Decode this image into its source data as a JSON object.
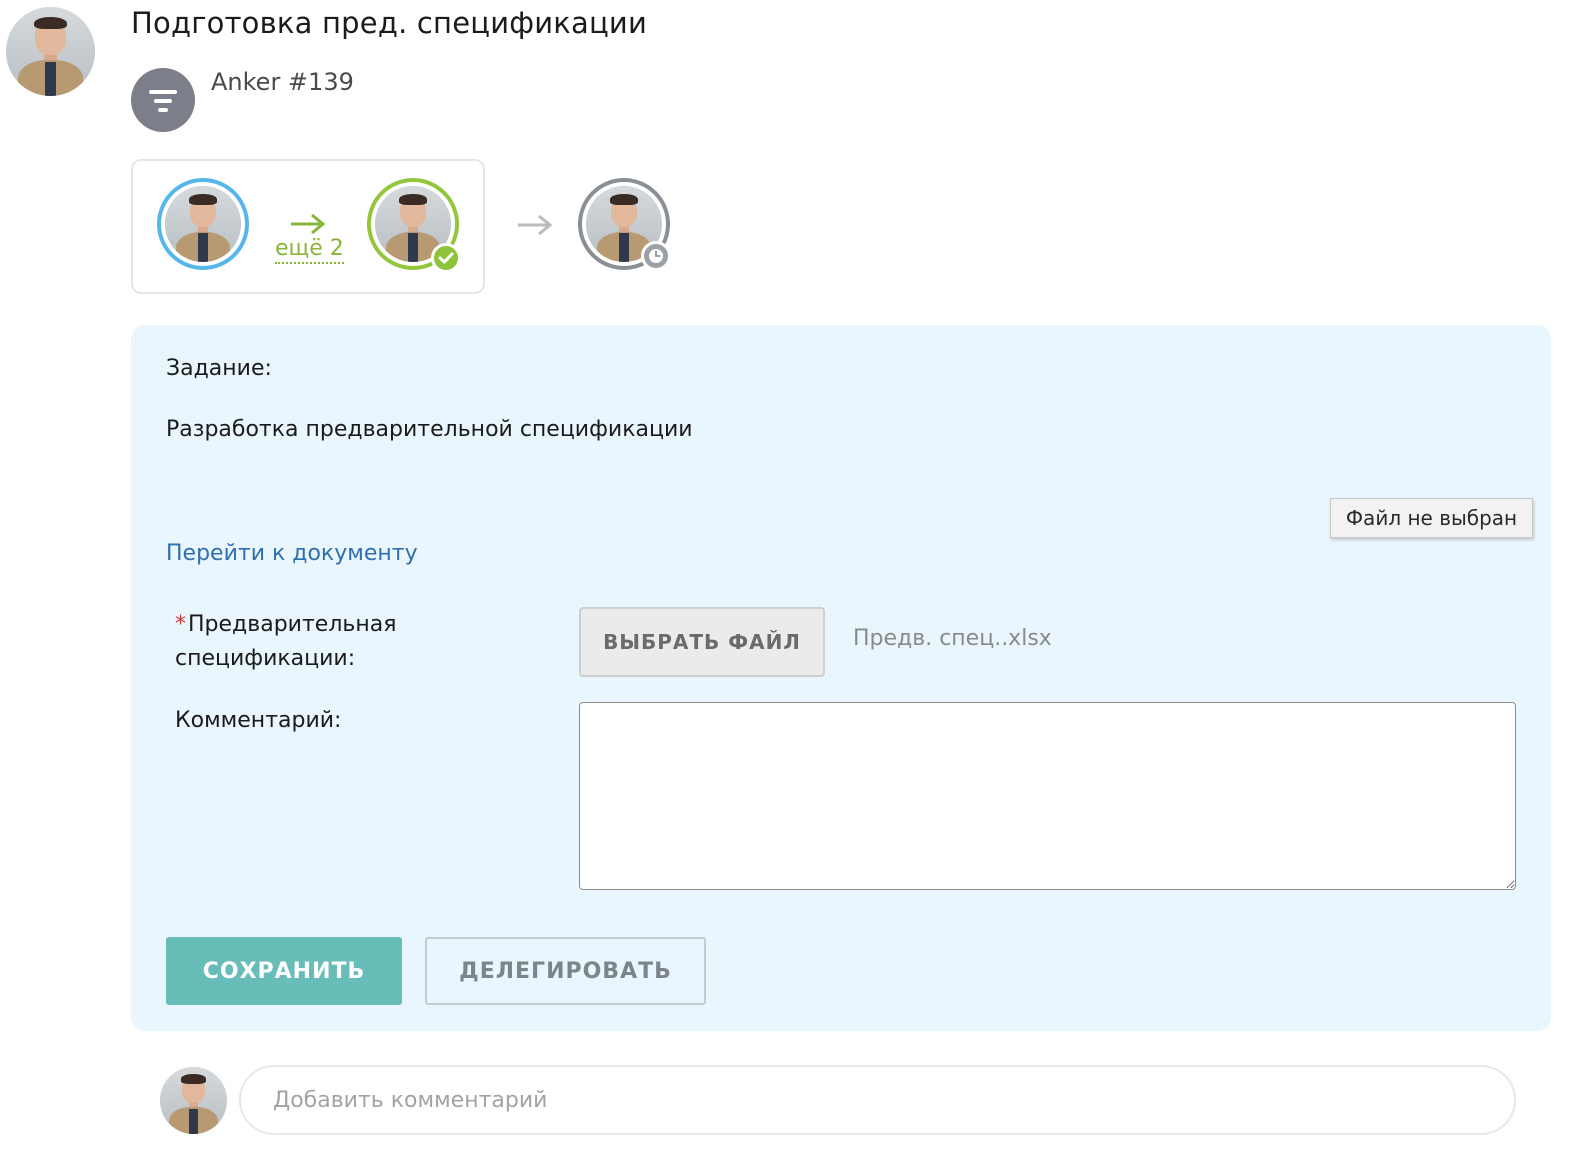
{
  "header": {
    "title": "Подготовка пред. спецификации",
    "source_label": "Anker #139",
    "source_icon": "filter-funnel-icon"
  },
  "route": {
    "more_label": "ещё 2",
    "steps": [
      {
        "state": "current",
        "ring_color": "#56b6ea"
      },
      {
        "state": "done",
        "ring_color": "#93c53d",
        "badge": "check-icon"
      },
      {
        "state": "pending",
        "ring_color": "#8a8e95",
        "badge": "clock-icon"
      }
    ]
  },
  "task": {
    "heading": "Задание:",
    "description": "Разработка предварительной спецификации",
    "doc_link": "Перейти к документу",
    "file_tooltip": "Файл не выбран",
    "spec_label_required": "*",
    "spec_label": "Предварительная спецификации:",
    "choose_file_label": "ВЫБРАТЬ ФАЙЛ",
    "file_name": "Предв. спец..xlsx",
    "comment_label": "Комментарий:",
    "comment_value": "",
    "save_label": "СОХРАНИТЬ",
    "delegate_label": "ДЕЛЕГИРОВАТЬ"
  },
  "composer": {
    "placeholder": "Добавить комментарий"
  },
  "colors": {
    "panel_bg": "#eaf6fd",
    "save_button": "#69bdb9",
    "link": "#2f6fb0",
    "accent_green": "#93c53d",
    "accent_blue": "#56b6ea"
  }
}
